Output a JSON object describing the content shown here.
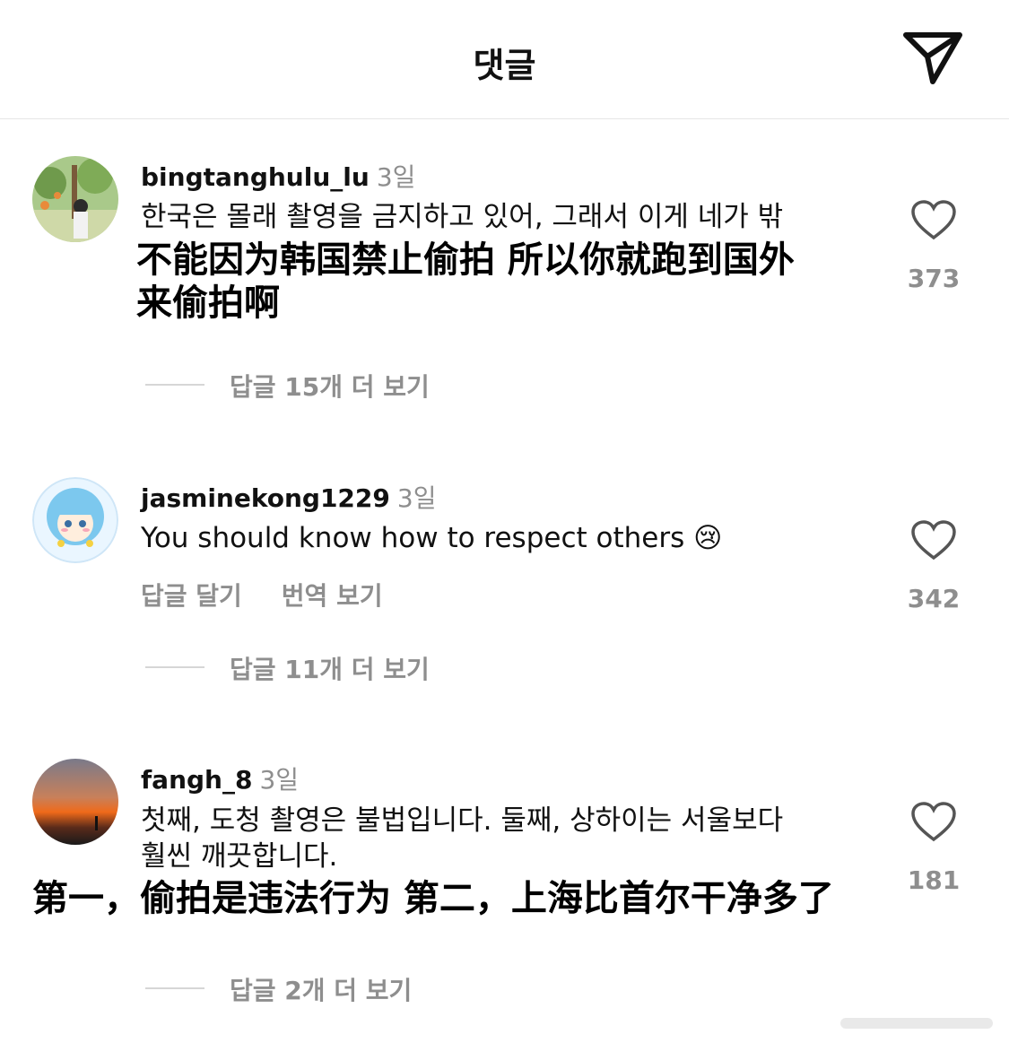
{
  "header": {
    "title": "댓글"
  },
  "comments": [
    {
      "username": "bingtanghulu_lu",
      "time": "3일",
      "text_lines": [
        "한국은 몰래 촬영을 금지하고 있어, 그래서 이게 네가 밖"
      ],
      "overlay_lines": [
        "不能因为韩国禁止偷拍  所以你就跑到国外",
        "来偷拍啊"
      ],
      "likes": "373",
      "view_replies": "답글 15개 더 보기"
    },
    {
      "username": "jasminekong1229",
      "time": "3일",
      "text_lines": [
        "You should know how to respect others 😢"
      ],
      "actions": {
        "reply": "답글 달기",
        "translate": "번역 보기"
      },
      "likes": "342",
      "view_replies": "답글 11개 더 보기"
    },
    {
      "username": "fangh_8",
      "time": "3일",
      "text_lines": [
        "첫째, 도청 촬영은 불법입니다. 둘째, 상하이는 서울보다",
        "훨씬 깨끗합니다."
      ],
      "overlay_lines": [
        "第一，偷拍是违法行为  第二，上海比首尔干净多了"
      ],
      "likes": "181",
      "view_replies": "답글 2개 더 보기"
    }
  ]
}
